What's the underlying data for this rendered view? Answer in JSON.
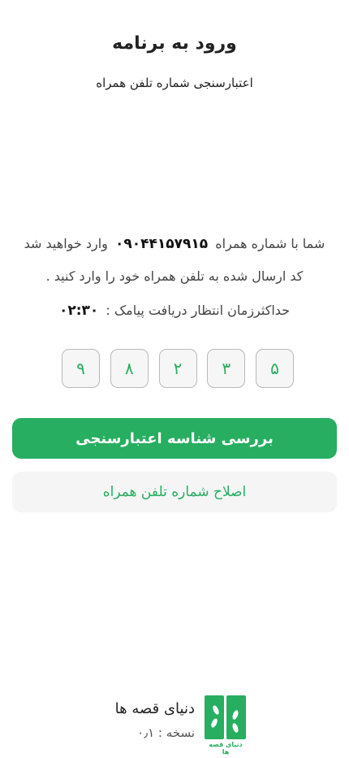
{
  "header": {
    "title": "ورود به برنامه",
    "subtitle": "اعتبارسنجی شماره تلفن همراه"
  },
  "message": {
    "before_phone": "شما با شماره همراه",
    "phone": "۰۹۰۴۴۱۵۷۹۱۵",
    "after_phone": "وارد خواهید شد",
    "line2": "کد ارسال شده به تلفن همراه خود را وارد کنید ."
  },
  "timer": {
    "label": "حداکثرزمان انتظار دریافت پیامک :",
    "value": "۰۲:۳۰"
  },
  "otp": {
    "digits": [
      "۵",
      "۳",
      "۲",
      "۸",
      "۹"
    ]
  },
  "buttons": {
    "verify_label": "بررسی شناسه اعتبارسنجی",
    "edit_phone_label": "اصلاح شماره تلفن همراه"
  },
  "brand": {
    "name": "دنیای قصه ها",
    "version": "نسخه : ۰٫۱",
    "logo_caption": "دنیای قصه ها"
  },
  "colors": {
    "accent": "#27ae60",
    "secondary_bg": "#f5f5f5",
    "otp_border": "#b9b9b9"
  }
}
